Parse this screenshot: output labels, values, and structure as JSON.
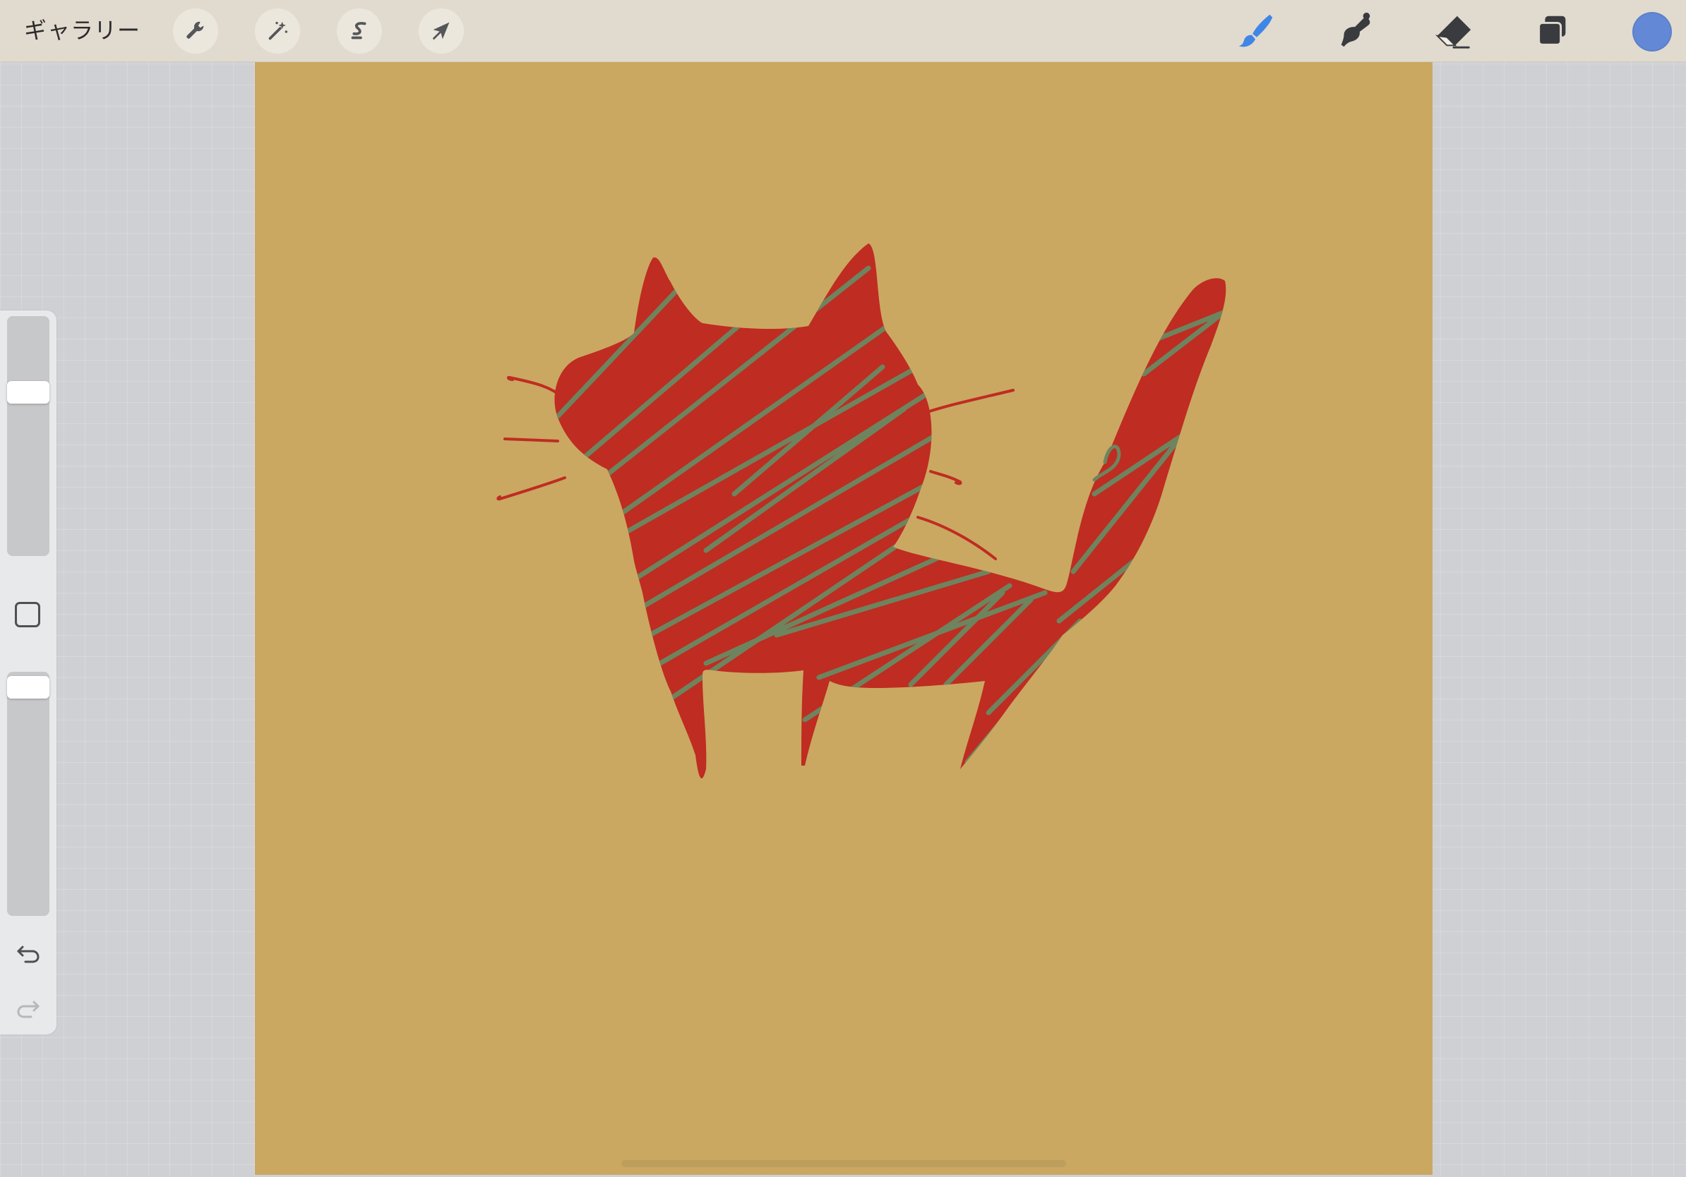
{
  "topbar": {
    "gallery_label": "ギャラリー",
    "left_tools": [
      "wrench-icon",
      "magic-wand-icon",
      "selection-icon",
      "transform-arrow-icon"
    ],
    "right_tools": [
      "brush-icon",
      "smudge-icon",
      "eraser-icon",
      "layers-icon"
    ],
    "active_tool": "brush",
    "current_color": "#6388d6"
  },
  "sidebar": {
    "brush_size_level": 0.3,
    "opacity_level": 0.02,
    "buttons": [
      "modify-square-icon",
      "undo-icon",
      "redo-icon"
    ]
  },
  "canvas": {
    "background_color": "#caa862",
    "cat_fill": "#bf2c21",
    "stripe_color": "#6e845e"
  }
}
